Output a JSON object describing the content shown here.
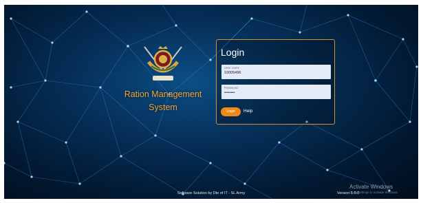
{
  "app": {
    "title_line1": "Ration Management",
    "title_line2": "System"
  },
  "login": {
    "heading": "Login",
    "username": {
      "label": "User name",
      "value": "10005496"
    },
    "password": {
      "label": "Password",
      "value": "••••••••"
    },
    "login_button": "Login",
    "help_link": "Help"
  },
  "footer": {
    "credit": "Software Solution by Dte of IT - SL Army",
    "version": "Version 1.0.0"
  },
  "watermark": {
    "title": "Activate Windows",
    "subtitle": "Go to Settings to activate Windows."
  },
  "icons": {
    "emblem": "army-crest-icon"
  },
  "colors": {
    "accent": "#ee8a1b",
    "title": "#f0a43a",
    "panel_border": "#d8902a",
    "background": "#06305a"
  }
}
